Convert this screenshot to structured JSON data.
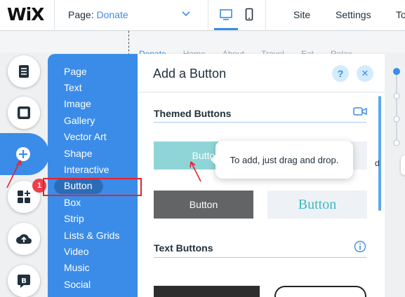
{
  "topbar": {
    "logo": "WiX",
    "page_prefix": "Page: ",
    "page_name": "Donate",
    "nav": [
      "Site",
      "Settings",
      "To"
    ]
  },
  "site_menu": [
    "Donate",
    "Home",
    "About",
    "Travel",
    "Eat",
    "Relax"
  ],
  "rail": {
    "badge_count": "1",
    "icons": [
      "pages-icon",
      "background-icon",
      "add-icon",
      "app-market-icon",
      "upload-icon",
      "blog-icon"
    ]
  },
  "add_menu": {
    "items": [
      "Page",
      "Text",
      "Image",
      "Gallery",
      "Vector Art",
      "Shape",
      "Interactive",
      "Button",
      "Box",
      "Strip",
      "Lists & Grids",
      "Video",
      "Music",
      "Social"
    ],
    "selected": "Button"
  },
  "panel": {
    "title": "Add a Button",
    "help": "?",
    "close": "✕",
    "themed_title": "Themed Buttons",
    "text_buttons_title": "Text Buttons",
    "themed_buttons": [
      "Butto",
      "",
      "Button",
      "Button"
    ],
    "tooltip": "To add, just drag and drop."
  },
  "right_chip": "d",
  "colors": {
    "accent": "#3b8ce8",
    "annotation": "#e8222a"
  }
}
